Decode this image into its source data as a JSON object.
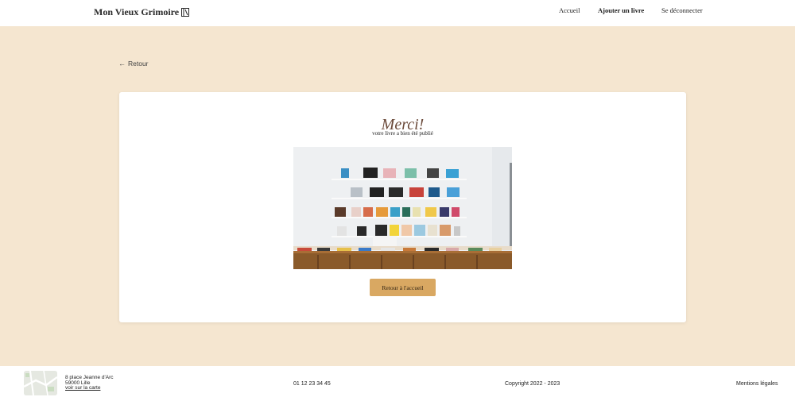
{
  "header": {
    "logo_text": "Mon Vieux Grimoire",
    "logo_icon": "book-icon",
    "nav": {
      "home": "Accueil",
      "add_book": "Ajouter un livre",
      "logout": "Se déconnecter"
    }
  },
  "back_link": {
    "label": "Retour",
    "icon": "arrow-left-icon"
  },
  "confirmation": {
    "title": "Merci!",
    "subtitle": "votre livre a bien été publié",
    "image": "bookshelf-photo",
    "button_label": "Retour à l'accueil"
  },
  "footer": {
    "address_line1": "8 place Jeanne d'Arc",
    "address_line2": "59000 Lille",
    "map_link": "voir sur la carte",
    "phone": "01 12 23 34 45",
    "copyright": "Copyright 2022 - 2023",
    "legal": "Mentions légales"
  },
  "colors": {
    "background": "#f5e6d0",
    "accent_button": "#d9a862",
    "title_color": "#6b4a3a",
    "card": "#ffffff"
  }
}
